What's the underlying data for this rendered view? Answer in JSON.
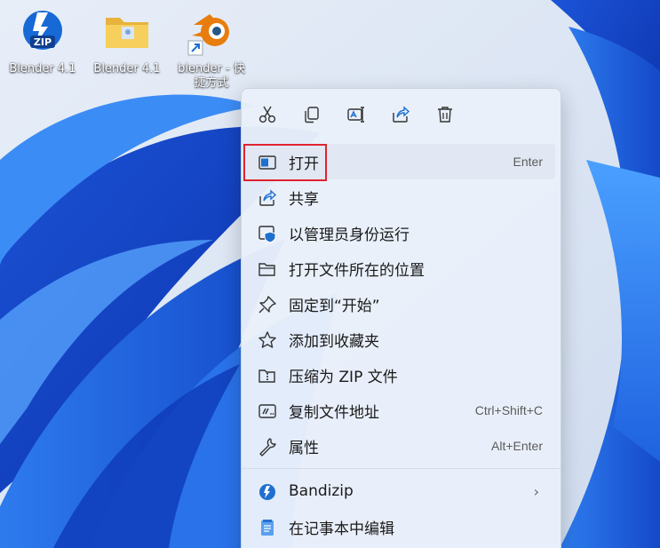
{
  "desktop": {
    "icons": [
      {
        "label": "Blender 4.1",
        "icon": "zip-archive-icon"
      },
      {
        "label": "Blender 4.1",
        "icon": "folder-icon"
      },
      {
        "label": "blender - 快捷方式",
        "icon": "blender-shortcut-icon"
      }
    ],
    "wallpaper": "windows-11-bloom"
  },
  "context_menu": {
    "quick_actions": [
      {
        "name": "cut",
        "icon": "cut-icon"
      },
      {
        "name": "copy",
        "icon": "copy-icon"
      },
      {
        "name": "rename",
        "icon": "rename-icon"
      },
      {
        "name": "share",
        "icon": "share-icon"
      },
      {
        "name": "delete",
        "icon": "delete-icon"
      }
    ],
    "items": [
      {
        "label": "打开",
        "shortcut": "Enter",
        "icon": "open-icon"
      },
      {
        "label": "共享",
        "shortcut": "",
        "icon": "share-icon"
      },
      {
        "label": "以管理员身份运行",
        "shortcut": "",
        "icon": "admin-shield-icon"
      },
      {
        "label": "打开文件所在的位置",
        "shortcut": "",
        "icon": "folder-open-icon"
      },
      {
        "label": "固定到“开始”",
        "shortcut": "",
        "icon": "pin-icon"
      },
      {
        "label": "添加到收藏夹",
        "shortcut": "",
        "icon": "star-icon"
      },
      {
        "label": "压缩为 ZIP 文件",
        "shortcut": "",
        "icon": "zip-folder-icon"
      },
      {
        "label": "复制文件地址",
        "shortcut": "Ctrl+Shift+C",
        "icon": "copy-path-icon"
      },
      {
        "label": "属性",
        "shortcut": "Alt+Enter",
        "icon": "wrench-icon"
      }
    ],
    "extra_items": [
      {
        "label": "Bandizip",
        "icon": "bandizip-icon",
        "submenu_arrow": "›"
      },
      {
        "label": "在记事本中编辑",
        "icon": "notepad-icon"
      }
    ]
  },
  "colors": {
    "highlight": "#e0232e",
    "accent": "#1f6fcf"
  }
}
